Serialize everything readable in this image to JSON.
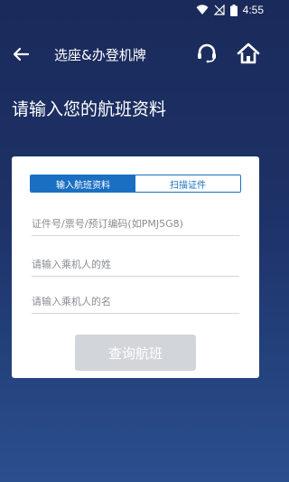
{
  "status_bar": {
    "time": "4:55",
    "icons": [
      "wifi-icon",
      "signal-off-icon",
      "battery-icon"
    ]
  },
  "header": {
    "back_icon": "back-arrow-icon",
    "title": "选座&办登机牌",
    "support_icon": "headset-icon",
    "home_icon": "home-icon"
  },
  "page": {
    "title": "请输入您的航班资料"
  },
  "form": {
    "tabs": [
      {
        "label": "输入航班资料",
        "active": true
      },
      {
        "label": "扫描证件",
        "active": false
      }
    ],
    "fields": {
      "document_placeholder": "证件号/票号/预订编码(如PMJ5G8)",
      "document_value": "",
      "last_name_placeholder": "请输入乘机人的姓",
      "last_name_value": "",
      "first_name_placeholder": "请输入乘机人的名",
      "first_name_value": ""
    },
    "submit_label": "查询航班",
    "submit_enabled": false
  },
  "colors": {
    "background_top": "#1a2a5a",
    "background_bottom": "#2a4f8e",
    "accent": "#1b6fc2",
    "button_disabled": "#d2d6db"
  }
}
